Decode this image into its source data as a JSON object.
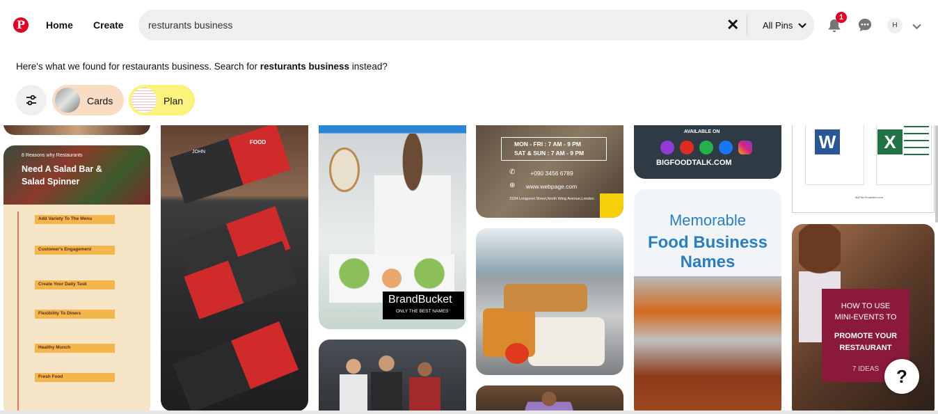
{
  "header": {
    "nav": {
      "home": "Home",
      "create": "Create"
    },
    "search": {
      "value": "resturants business",
      "filter": "All Pins"
    },
    "notifications_count": "1",
    "avatar_initial": "H"
  },
  "notice": {
    "prefix": "Here's what we found for restaurants business. Search for ",
    "query": "resturants business",
    "suffix": " instead?"
  },
  "chips": [
    {
      "label": "Cards",
      "color": "#f9dcc4"
    },
    {
      "label": "Plan",
      "color": "#fbf37d"
    }
  ],
  "pins": {
    "salad": {
      "title_line1": "8 Reasons why Restaurants",
      "title_line2": "Need A Salad Bar &",
      "title_line3": "Salad Spinner",
      "items": [
        "Add Variety To The Menu",
        "Customer's Engagement",
        "Create Your Daily Task",
        "Flexibility To Diners",
        "Healthy Munch",
        "Fresh Food"
      ]
    },
    "cards": {
      "name": "JOHN",
      "brand": "FOOD"
    },
    "brandbucket": {
      "logo": "BrandBucket",
      "tagline": "ONLY THE BEST NAMES"
    },
    "hours": {
      "line1": "MON - FRI : 7 AM - 9 PM",
      "line2": "SAT & SUN : 7 AM - 9 PM",
      "phone": "+090 3456 6789",
      "web": "www.webpage.com",
      "address": "2234 Longonet Street,North Wing Avenue,London"
    },
    "bigfood": {
      "available": "AVAILABLE ON",
      "site": "BIGFOODTALK.COM"
    },
    "foodnames": {
      "line1": "Memorable",
      "line2": "Food Business",
      "line3": "Names"
    },
    "office": {
      "word": "W",
      "excel": "X",
      "caption": "MyPlanTemplates.com"
    },
    "minievents": {
      "line1": "HOW TO USE",
      "line2": "MINI-EVENTS TO",
      "line3": "PROMOTE YOUR",
      "line4": "RESTAURANT",
      "line5": "7 IDEAS"
    }
  },
  "help_label": "?"
}
